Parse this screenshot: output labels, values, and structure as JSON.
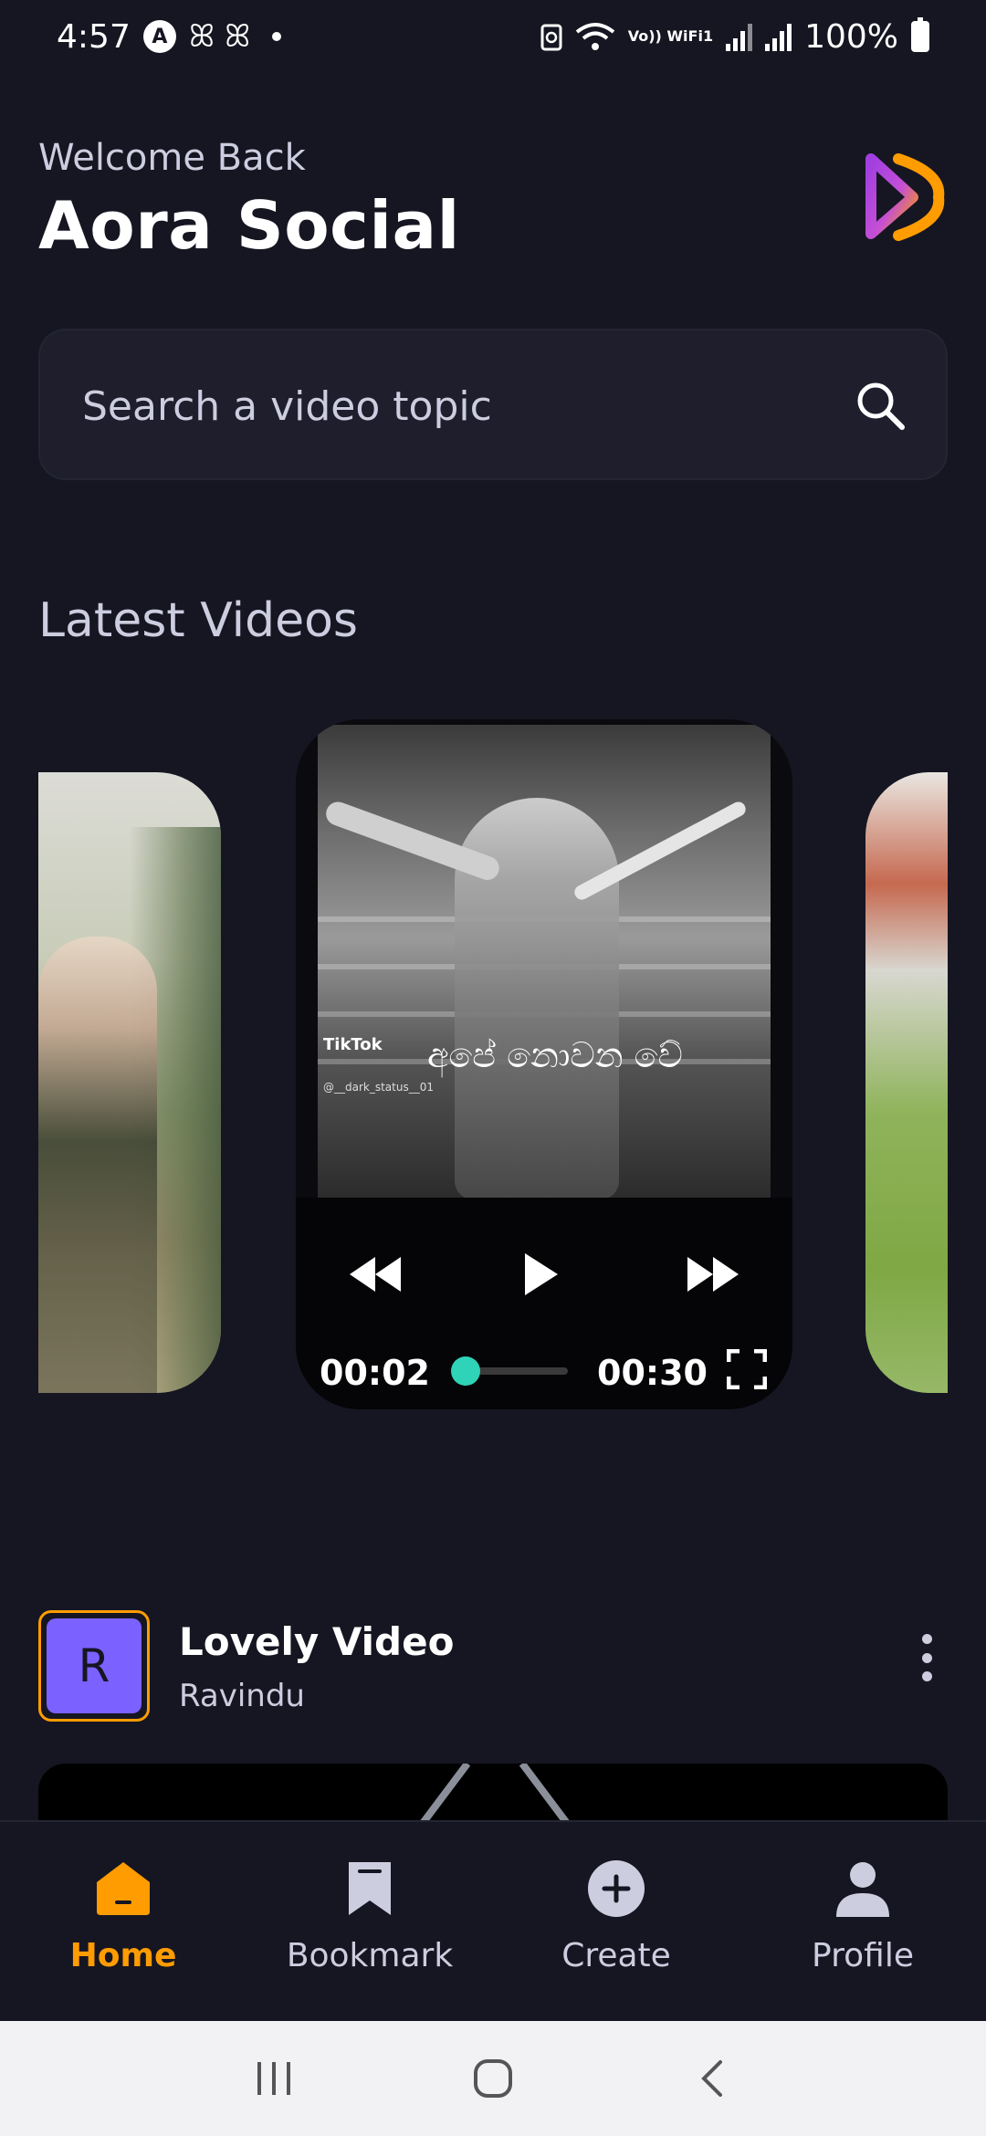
{
  "status_bar": {
    "time": "4:57",
    "badge_letter": "A",
    "glyphs": "ꕤ ꕤ",
    "net_label": "Vo)) WiFi1",
    "battery": "100%"
  },
  "header": {
    "welcome": "Welcome Back",
    "title": "Aora Social",
    "logo_colors": {
      "purple": "#a13ee0",
      "orange": "#ff9c01"
    }
  },
  "search": {
    "placeholder": "Search a video topic",
    "value": ""
  },
  "latest": {
    "title": "Latest Videos",
    "player": {
      "watermark_brand": "TikTok",
      "watermark_handle": "@__dark_status__01",
      "caption": "අපේ නොවන වේ",
      "current_time": "00:02",
      "total_time": "00:30",
      "progress": 0.067,
      "accent": "#2fd3b7"
    }
  },
  "post": {
    "avatar_letter": "R",
    "title": "Lovely Video",
    "author": "Ravindu"
  },
  "tabs": [
    {
      "label": "Home",
      "icon": "home-icon",
      "active": true
    },
    {
      "label": "Bookmark",
      "icon": "bookmark-icon",
      "active": false
    },
    {
      "label": "Create",
      "icon": "plus-icon",
      "active": false
    },
    {
      "label": "Profile",
      "icon": "profile-icon",
      "active": false
    }
  ],
  "colors": {
    "background": "#161622",
    "accent": "#ff9c01",
    "muted": "#cdcde0"
  }
}
